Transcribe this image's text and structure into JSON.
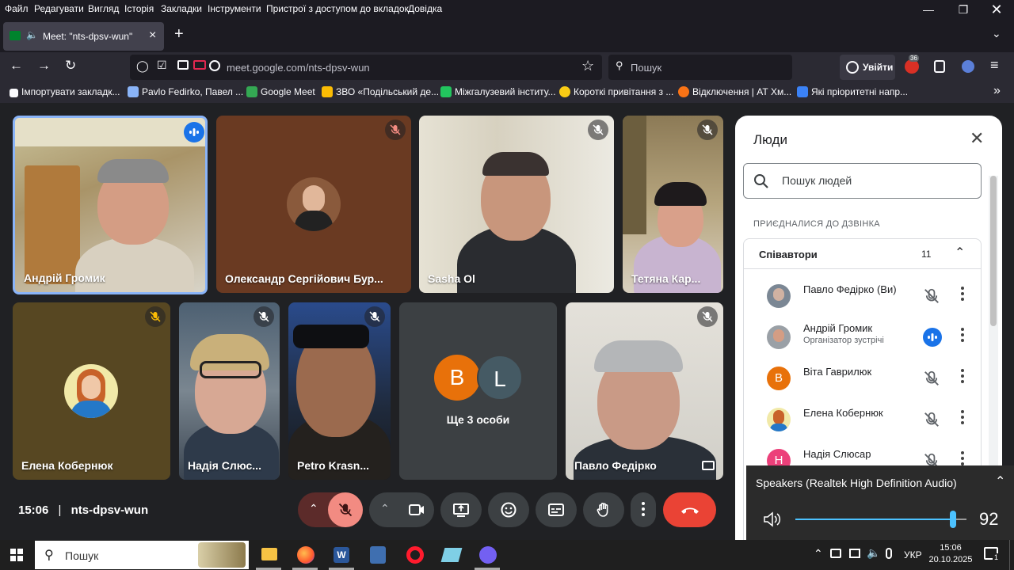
{
  "menubar": {
    "items": [
      "Файл",
      "Редагувати",
      "Вигляд",
      "Історія",
      "Закладки",
      "Інструменти",
      "Пристрої з доступом до вкладок",
      "Довідка"
    ]
  },
  "tab": {
    "title": "Meet: \"nts-dpsv-wun\"",
    "close": "×",
    "new_tab": "+"
  },
  "nav": {
    "url_host": "meet.google.com",
    "url_path": "/nts-dpsv-wun",
    "search_placeholder": "Пошук",
    "signin_label": "Увійти",
    "badge_count": "36"
  },
  "bookmarks": [
    {
      "label": "Імпортувати закладк...",
      "color": "#fbfbfe"
    },
    {
      "label": "Pavlo Fedirko, Павел ...",
      "color": "#8ab4f8"
    },
    {
      "label": "Google Meet",
      "color": "#34a853"
    },
    {
      "label": "ЗВО «Подільський де...",
      "color": "#fbbc04"
    },
    {
      "label": "Міжгалузевий інститу...",
      "color": "#22c55e"
    },
    {
      "label": "Короткі привітання з ...",
      "color": "#facc15"
    },
    {
      "label": "Відключення | АТ Хм...",
      "color": "#f97316"
    },
    {
      "label": "Які пріоритетні напр...",
      "color": "#3b82f6"
    }
  ],
  "tiles": [
    {
      "name": "Андрій Громик",
      "speaking": true
    },
    {
      "name": "Олександр Сергійович Бур..."
    },
    {
      "name": "Sasha Ol"
    },
    {
      "name": "Тетяна Кар..."
    },
    {
      "name": "Елена Кобернюк"
    },
    {
      "name": "Надія Слюс..."
    },
    {
      "name": "Petro Krasn..."
    },
    {
      "name": "Ще 3 особи",
      "avatars": [
        "B",
        "L"
      ]
    },
    {
      "name": "Павло Федірко"
    }
  ],
  "meeting": {
    "time": "15:06",
    "separator": "|",
    "code": "nts-dpsv-wun"
  },
  "panel": {
    "title": "Люди",
    "search_placeholder": "Пошук людей",
    "section_label": "ПРИЄДНАЛИСЯ ДО ДЗВІНКА",
    "group_label": "Співавтори",
    "group_count": "11",
    "people": [
      {
        "name": "Павло Федірко (Ви)",
        "subtitle": "",
        "avatar": "",
        "avatar_color": "#7b8794"
      },
      {
        "name": "Андрій Громик",
        "subtitle": "Організатор зустрічі",
        "avatar": "",
        "avatar_color": "#9aa0a6"
      },
      {
        "name": "Віта Гаврилюк",
        "subtitle": "",
        "avatar": "В",
        "avatar_color": "#e8710a"
      },
      {
        "name": "Елена Кобернюк",
        "subtitle": "",
        "avatar": "",
        "avatar_color": "#c58b3a"
      },
      {
        "name": "Надія Слюсар",
        "subtitle": "",
        "avatar": "Н",
        "avatar_color": "#ec407a"
      }
    ]
  },
  "speakers": {
    "label": "Speakers (Realtek High Definition Audio)",
    "volume": "92",
    "volume_fraction": 0.92
  },
  "taskbar": {
    "search_placeholder": "Пошук",
    "language": "УКР",
    "time": "15:06",
    "date": "20.10.2025",
    "notifications": "1"
  },
  "colors": {
    "accent_blue": "#1a73e8",
    "end_call_red": "#ea4335",
    "mic_off_red": "#f28b82"
  }
}
